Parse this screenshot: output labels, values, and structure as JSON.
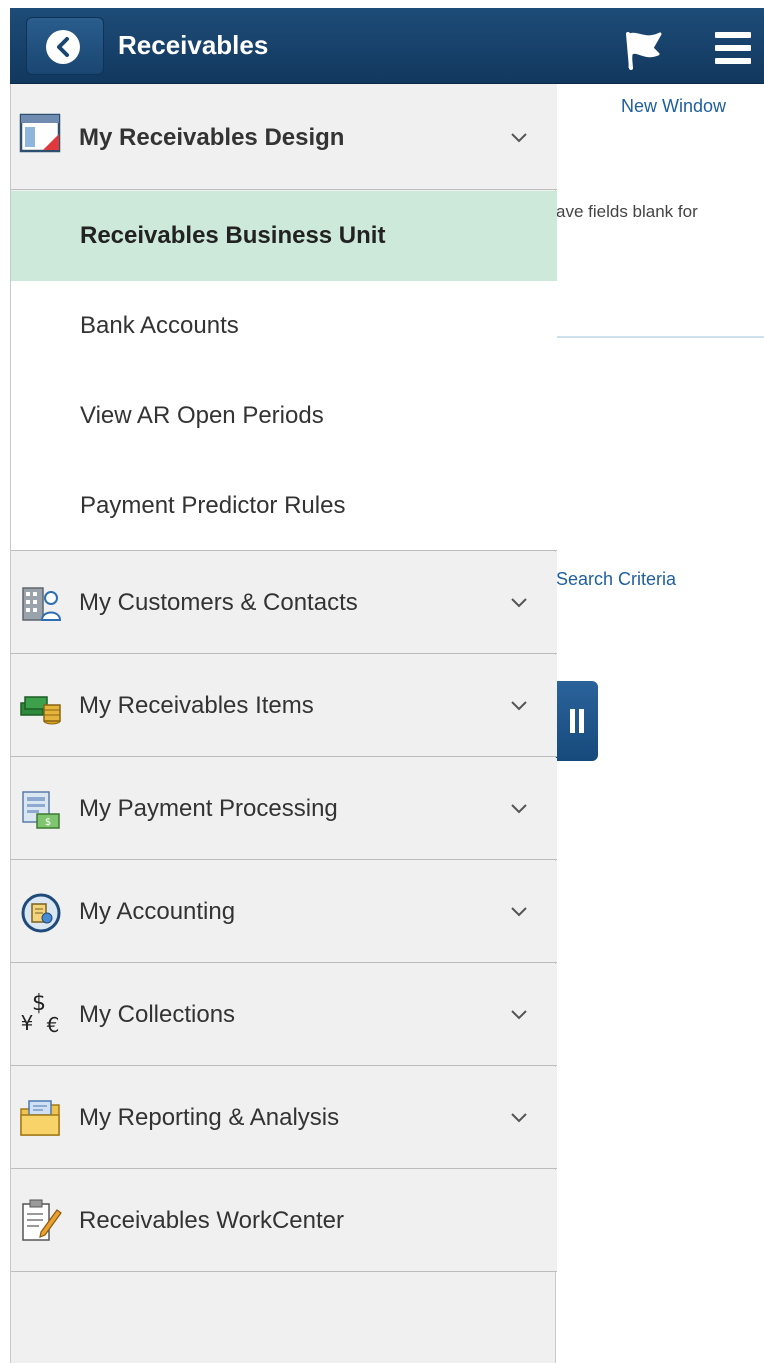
{
  "header": {
    "title": "Receivables",
    "back_icon": "chevron-left-icon",
    "flag_icon": "flag-icon",
    "menu_icon": "hamburger-menu-icon"
  },
  "background": {
    "new_window_link": "New Window",
    "instruction_text": "ave fields blank for",
    "search_criteria_link": "Search Criteria"
  },
  "nav": {
    "design": {
      "label": "My Receivables Design",
      "icon": "design-icon",
      "items": [
        {
          "label": "Receivables Business Unit",
          "active": true
        },
        {
          "label": "Bank Accounts"
        },
        {
          "label": "View AR Open Periods"
        },
        {
          "label": "Payment Predictor Rules"
        }
      ]
    },
    "groups": [
      {
        "label": "My Customers & Contacts",
        "icon": "customers-icon"
      },
      {
        "label": "My Receivables Items",
        "icon": "money-stack-icon"
      },
      {
        "label": "My Payment Processing",
        "icon": "payment-processing-icon"
      },
      {
        "label": "My Accounting",
        "icon": "accounting-icon"
      },
      {
        "label": "My Collections",
        "icon": "currency-icon"
      },
      {
        "label": "My Reporting & Analysis",
        "icon": "folder-icon"
      },
      {
        "label": "Receivables WorkCenter",
        "icon": "clipboard-icon"
      }
    ]
  },
  "colors": {
    "header_bg": "#1a4672",
    "active_item_bg": "#cde9d9",
    "link": "#1e5f9f",
    "panel_bg": "#f0f0f0"
  }
}
